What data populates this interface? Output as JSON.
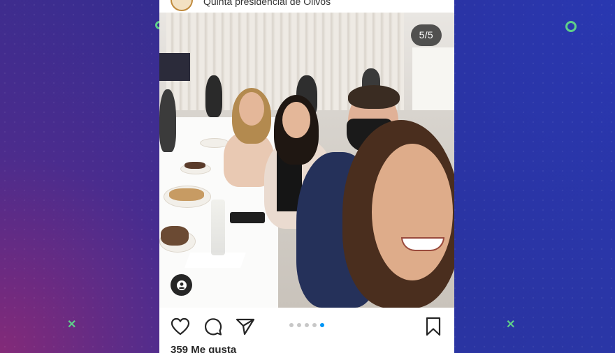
{
  "post": {
    "location": "Quinta presidencial de Olivos",
    "carousel_counter": "5/5",
    "carousel_total": 5,
    "carousel_current": 5,
    "likes": "359 Me gusta"
  },
  "icons": {
    "like": "heart-icon",
    "comment": "comment-bubble-icon",
    "share": "paper-plane-icon",
    "save": "bookmark-icon",
    "tag": "user-tag-icon"
  },
  "colors": {
    "accent_dot": "#0095f6",
    "inactive_dot": "#c7c7c7",
    "background_start": "#3a2d8f",
    "background_end": "#2a36a6",
    "decoration": "#5fcf8a"
  }
}
